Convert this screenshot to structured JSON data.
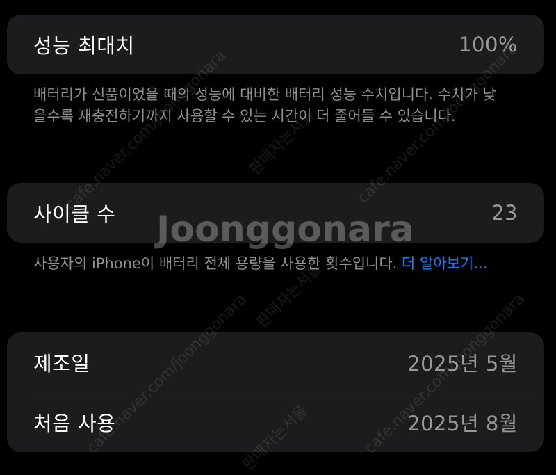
{
  "peak_performance": {
    "label": "성능 최대치",
    "value": "100%",
    "description": "배터리가 신품이었을 때의 성능에 대비한 배터리 성능 수치입니다. 수치가 낮을수록 재충전하기까지 사용할 수 있는 시간이 더 줄어들 수 있습니다."
  },
  "cycle_count": {
    "label": "사이클 수",
    "value": "23",
    "description": "사용자의 iPhone이 배터리 전체 용량을 사용한 횟수입니다. ",
    "learn_more": "더 알아보기..."
  },
  "dates": {
    "manufacture": {
      "label": "제조일",
      "value": "2025년 5월"
    },
    "first_use": {
      "label": "처음 사용",
      "value": "2025년 8월"
    }
  },
  "watermark": {
    "logo": "Joonggonara",
    "cafe": "cafe.naver.com/joonggonara",
    "tag": "판매자는서울"
  },
  "colors": {
    "background": "#000000",
    "card": "#1c1c1e",
    "secondary_text": "#8e8e93",
    "value_text": "#98989d",
    "link": "#0a84ff"
  }
}
